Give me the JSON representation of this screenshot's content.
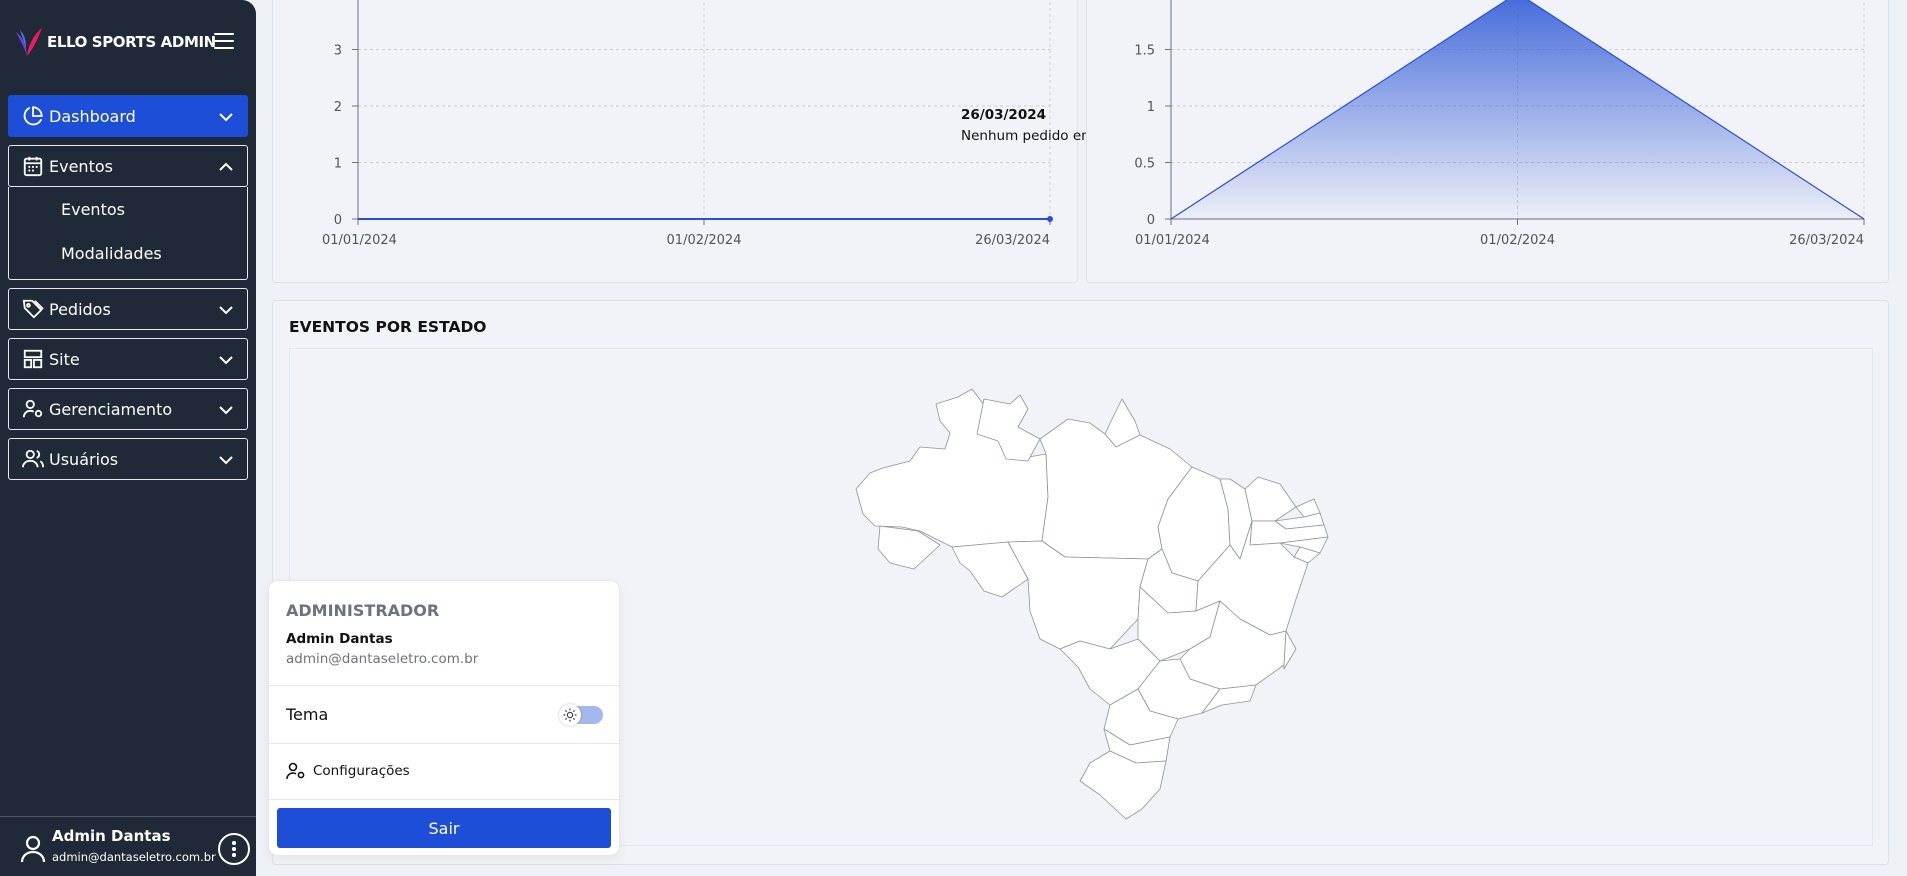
{
  "brand": {
    "name": "ELLO SPORTS ADMIN"
  },
  "sidebar": {
    "items": [
      {
        "label": "Dashboard",
        "icon": "pie-chart-icon",
        "active": true,
        "expanded": false
      },
      {
        "label": "Eventos",
        "icon": "calendar-icon",
        "active": false,
        "expanded": true,
        "children": [
          {
            "label": "Eventos"
          },
          {
            "label": "Modalidades"
          }
        ]
      },
      {
        "label": "Pedidos",
        "icon": "tag-icon",
        "active": false,
        "expanded": false
      },
      {
        "label": "Site",
        "icon": "layout-icon",
        "active": false,
        "expanded": false
      },
      {
        "label": "Gerenciamento",
        "icon": "user-gear-icon",
        "active": false,
        "expanded": false
      },
      {
        "label": "Usuários",
        "icon": "users-icon",
        "active": false,
        "expanded": false
      }
    ],
    "footer": {
      "name": "Admin Dantas",
      "email": "admin@dantaseletro.com.br"
    }
  },
  "chart_data": [
    {
      "type": "line",
      "title": "",
      "x": [
        "01/01/2024",
        "01/02/2024",
        "26/03/2024"
      ],
      "yticks": [
        0,
        1,
        2,
        3
      ],
      "series": [
        {
          "values": [
            0,
            0,
            0
          ]
        }
      ],
      "tooltip": {
        "date": "26/03/2024",
        "message": "Nenhum pedido encontrado"
      },
      "grid": true
    },
    {
      "type": "area",
      "title": "",
      "x": [
        "01/01/2024",
        "01/02/2024",
        "26/03/2024"
      ],
      "yticks": [
        "0",
        "0.5",
        "1",
        "1.5"
      ],
      "series": [
        {
          "values": [
            0,
            2,
            0
          ]
        }
      ],
      "grid": true
    }
  ],
  "map_section": {
    "title": "EVENTOS POR ESTADO"
  },
  "user_popup": {
    "role": "ADMINISTRADOR",
    "name": "Admin Dantas",
    "email": "admin@dantaseletro.com.br",
    "theme_label": "Tema",
    "theme_dark": false,
    "settings_label": "Configurações",
    "logout_label": "Sair"
  },
  "colors": {
    "sidebar": "#1f2937",
    "accent": "#1d4ed8",
    "background": "#eef1f6"
  }
}
